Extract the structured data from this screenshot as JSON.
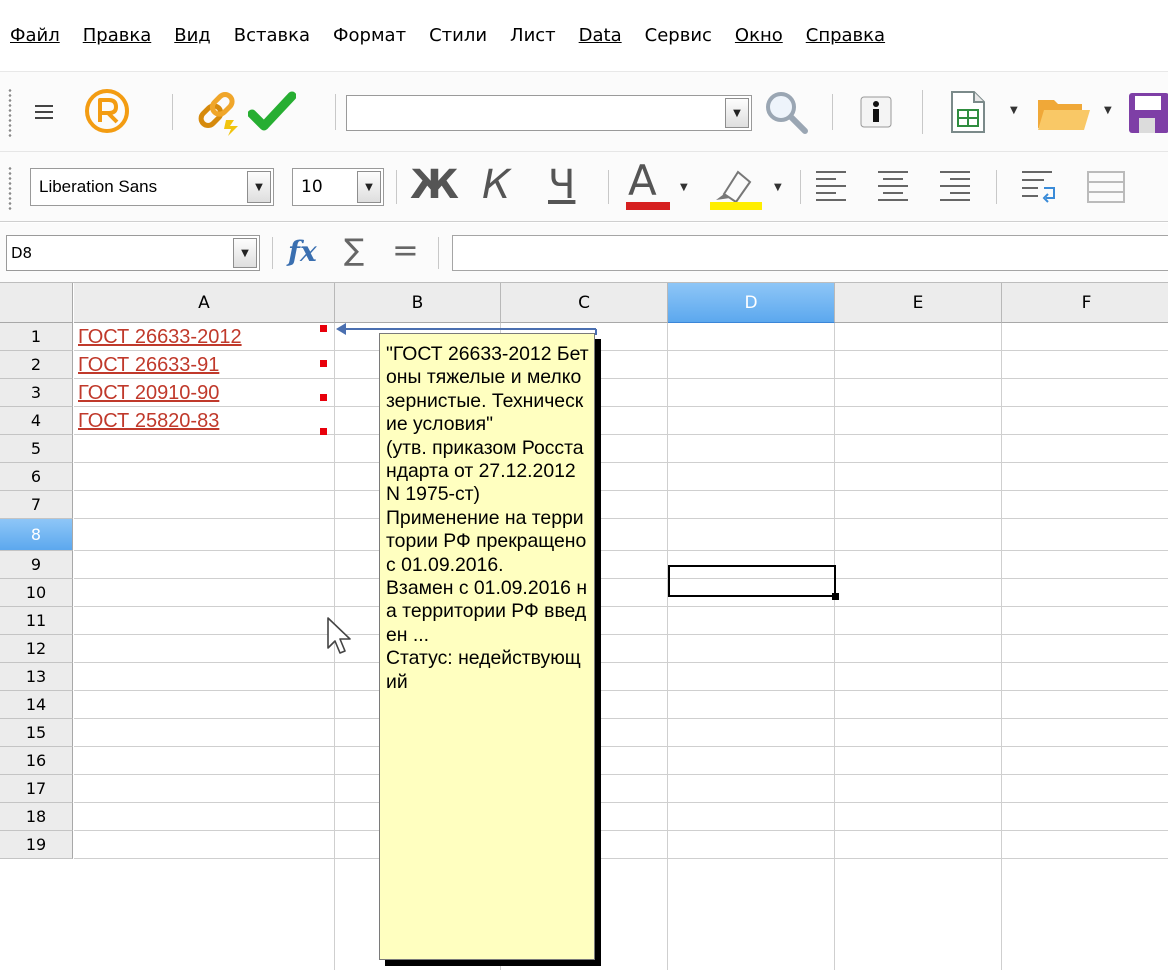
{
  "menu": [
    {
      "id": "file",
      "label": "Файл",
      "underline": true
    },
    {
      "id": "edit",
      "label": "Правка",
      "underline": true
    },
    {
      "id": "view",
      "label": "Вид",
      "underline": true
    },
    {
      "id": "insert",
      "label": "Вставка",
      "underline": false
    },
    {
      "id": "format",
      "label": "Формат",
      "underline": false
    },
    {
      "id": "styles",
      "label": "Стили",
      "underline": false
    },
    {
      "id": "sheet",
      "label": "Лист",
      "underline": false
    },
    {
      "id": "data",
      "label": "Data",
      "underline": true
    },
    {
      "id": "tools",
      "label": "Сервис",
      "underline": false
    },
    {
      "id": "window",
      "label": "Окно",
      "underline": true
    },
    {
      "id": "help",
      "label": "Справка",
      "underline": true
    }
  ],
  "toolbar1": {
    "search_value": "",
    "icons": [
      "menu-icon",
      "registered-icon",
      "hyperlink-icon",
      "checkmark-icon",
      "search-icon",
      "info-icon",
      "new-spreadsheet-icon",
      "open-folder-icon",
      "save-icon"
    ],
    "colors": {
      "registered": "#f39c12",
      "checkmark": "#27ae32",
      "folder": "#f5b64a",
      "save": "#7e3fa6"
    }
  },
  "toolbar2": {
    "font_name": "Liberation Sans",
    "font_size": "10",
    "bold_label": "Ж",
    "italic_label": "К",
    "underline_label": "Ч",
    "font_color_label": "A",
    "colors": {
      "font_color": "#d62020",
      "highlight": "#ffee00",
      "icons": "#555555"
    }
  },
  "formula_bar": {
    "cell_reference": "D8",
    "fx_label": "fx",
    "sum_label": "∑",
    "equals_label": "=",
    "value": ""
  },
  "grid": {
    "columns": [
      "A",
      "B",
      "C",
      "D",
      "E",
      "F"
    ],
    "active_column": "D",
    "active_row": "8",
    "rows": [
      "1",
      "2",
      "3",
      "4",
      "5",
      "6",
      "7",
      "8",
      "9",
      "10",
      "11",
      "12",
      "13",
      "14",
      "15",
      "16",
      "17",
      "18",
      "19"
    ],
    "links": [
      "ГОСТ 26633-2012",
      "ГОСТ 26633-91",
      "ГОСТ 20910-90",
      "ГОСТ 25820-83"
    ],
    "selected_cell": "D8"
  },
  "comment": {
    "text": "\"ГОСТ 26633-2012 Бетоны тяжелые и мелкозернистые. Технические условия\"\n(утв. приказом Росстандарта от 27.12.2012 N 1975-ст)\nПрименение на территории РФ прекращено с 01.09.2016.\nВзамен с 01.09.2016 на территории РФ введен ...\nСтатус: недействующий"
  }
}
